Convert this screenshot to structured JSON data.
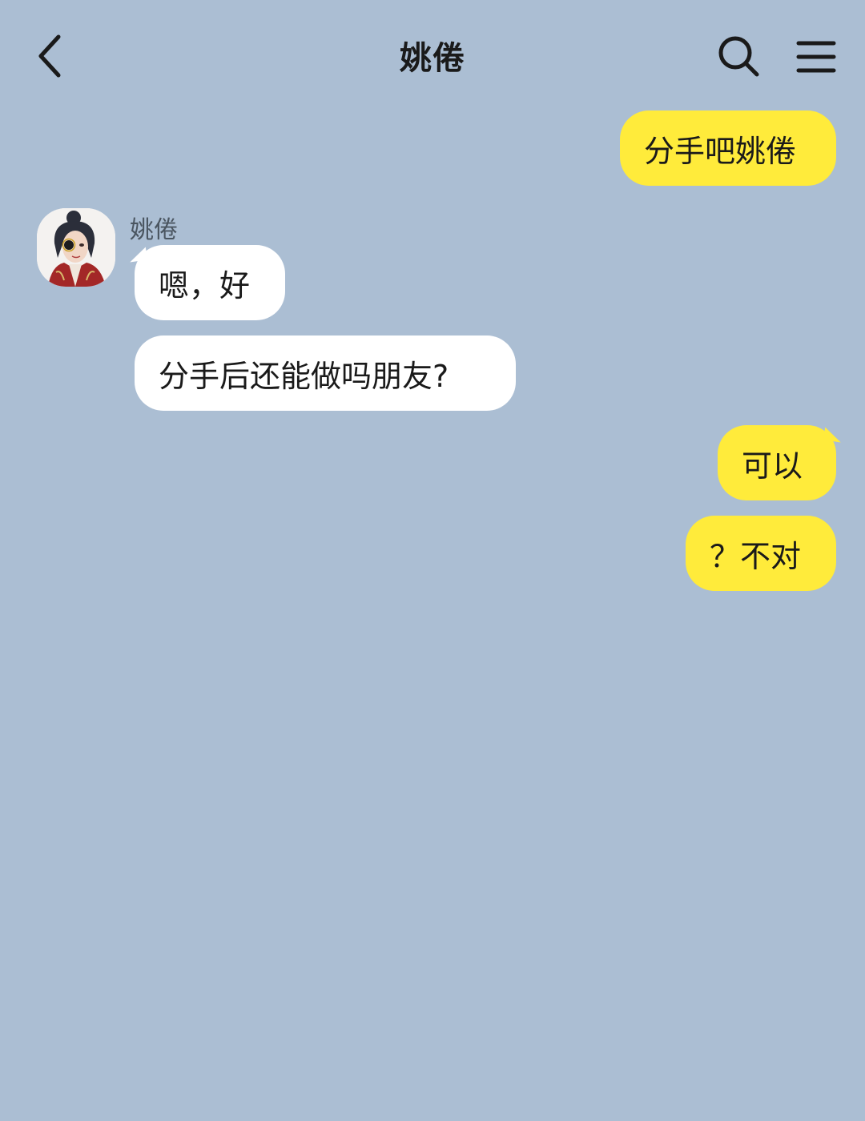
{
  "header": {
    "title": "姚倦",
    "back_icon": "chevron-left-icon",
    "search_icon": "search-icon",
    "menu_icon": "hamburger-menu-icon"
  },
  "colors": {
    "background": "#abbed3",
    "outgoing_bubble": "#ffeb3b",
    "incoming_bubble": "#ffffff"
  },
  "messages": [
    {
      "direction": "outgoing",
      "text": "分手吧姚倦"
    },
    {
      "direction": "incoming",
      "sender": "姚倦",
      "text": "嗯，好"
    },
    {
      "direction": "incoming",
      "text": "分手后还能做吗朋友?"
    },
    {
      "direction": "outgoing",
      "text": "可以"
    },
    {
      "direction": "outgoing",
      "text": "？不对"
    }
  ]
}
